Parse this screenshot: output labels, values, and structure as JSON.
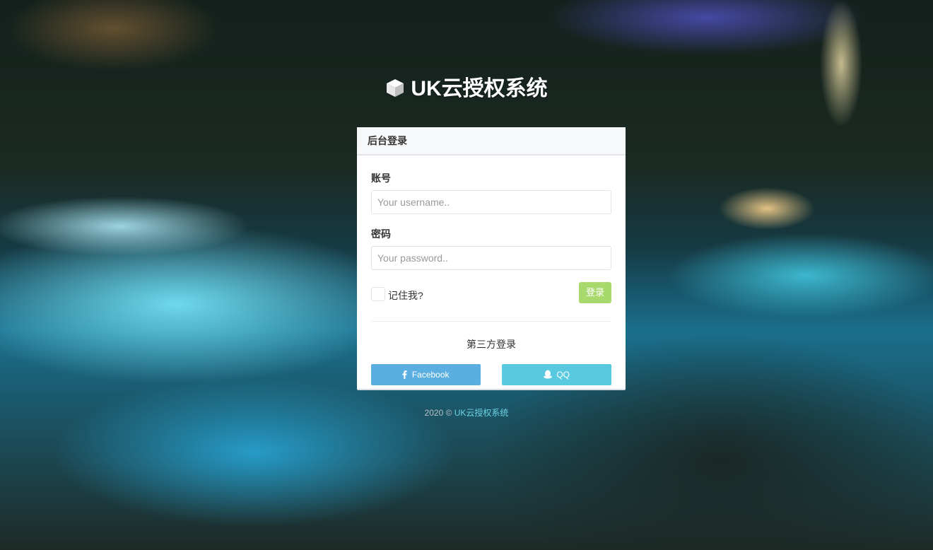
{
  "brand": {
    "title": "UK云授权系统",
    "icon": "cube-icon"
  },
  "panel": {
    "title": "后台登录",
    "username": {
      "label": "账号",
      "placeholder": "Your username.."
    },
    "password": {
      "label": "密码",
      "placeholder": "Your password.."
    },
    "remember_label": "记住我?",
    "login_label": "登录",
    "third_party_label": "第三方登录",
    "facebook_label": "Facebook",
    "qq_label": "QQ"
  },
  "footer": {
    "copyright": "2020 ©",
    "link_text": "UK云授权系统"
  },
  "colors": {
    "login_button": "#a8d96c",
    "facebook_button": "#5aaee0",
    "qq_button": "#58c9de",
    "footer_link": "#6fd3e3"
  }
}
